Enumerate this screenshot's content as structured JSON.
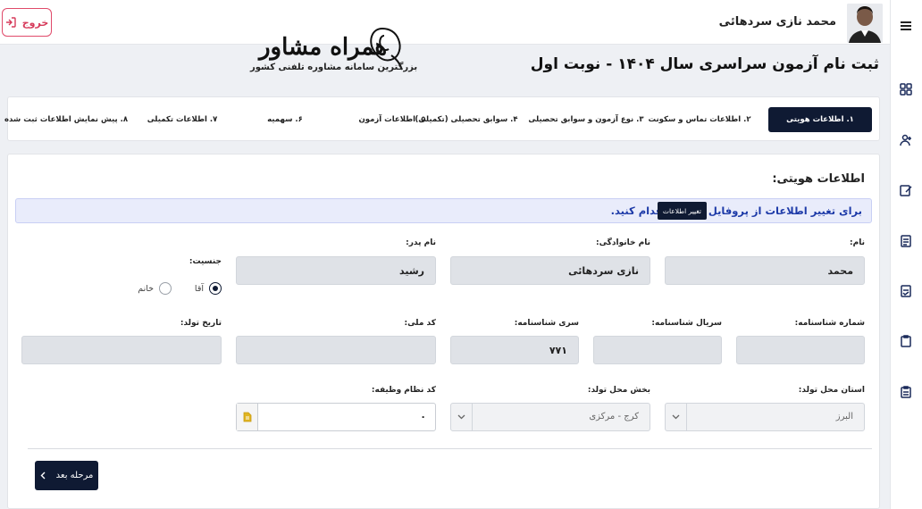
{
  "header": {
    "user_name": "محمد نازی سردهائی",
    "logout_label": "خروج",
    "logo_text": "همراه مشاور",
    "logo_subtitle": "بزرگترین سامانه مشاوره تلفنی کشور"
  },
  "page_title": "ثبت نام آزمون سراسری سال ۱۴۰۴ - نوبت اول",
  "steps": [
    {
      "label": "۱. اطلاعات هویتی",
      "active": true
    },
    {
      "label": "۲. اطلاعات تماس و سکونت"
    },
    {
      "label": "۳. نوع آزمون و سوابق تحصیلی"
    },
    {
      "label": "۴. سوابق تحصیلی (تکمیلی)"
    },
    {
      "label": "۵. اطلاعات آزمون"
    },
    {
      "label": "۶. سهمیه"
    },
    {
      "label": "۷. اطلاعات تکمیلی"
    },
    {
      "label": "۸. پیش نمایش اطلاعات ثبت شده"
    }
  ],
  "section": {
    "title": "اطلاعات هویتی:",
    "info_text": "برای تغییر اطلاعات از پروفایل کاربری اقدام کنید.",
    "info_button": "تغییر اطلاعات"
  },
  "fields": {
    "first_name": {
      "label": "نام:",
      "value": "محمد"
    },
    "last_name": {
      "label": "نام خانوادگی:",
      "value": "نازی سردهائی"
    },
    "father_name": {
      "label": "نام پدر:",
      "value": "رشید"
    },
    "gender": {
      "label": "جنسیت:",
      "options": [
        "آقا",
        "خانم"
      ],
      "selected": "آقا"
    },
    "id_number": {
      "label": "شماره شناسنامه:",
      "value": ""
    },
    "id_serial": {
      "label": "سریال شناسنامه:",
      "value": ""
    },
    "id_series": {
      "label": "سری شناسنامه:",
      "value": "۷۷۱"
    },
    "national_code": {
      "label": "کد ملی:",
      "value": ""
    },
    "birth_date": {
      "label": "تاریخ تولد:",
      "value": ""
    },
    "birth_province": {
      "label": "استان محل تولد:",
      "value": "البرز"
    },
    "birth_district": {
      "label": "بخش محل تولد:",
      "value": "کرج - مرکزی"
    },
    "military_code": {
      "label": "کد نظام وظیفه:",
      "value": "۰"
    }
  },
  "next_button": "مرحله بعد",
  "colors": {
    "primary": "#0f1a33",
    "logout": "#d63a5a",
    "info_bg": "#e9ecfb",
    "info_text": "#1d3aa8"
  }
}
